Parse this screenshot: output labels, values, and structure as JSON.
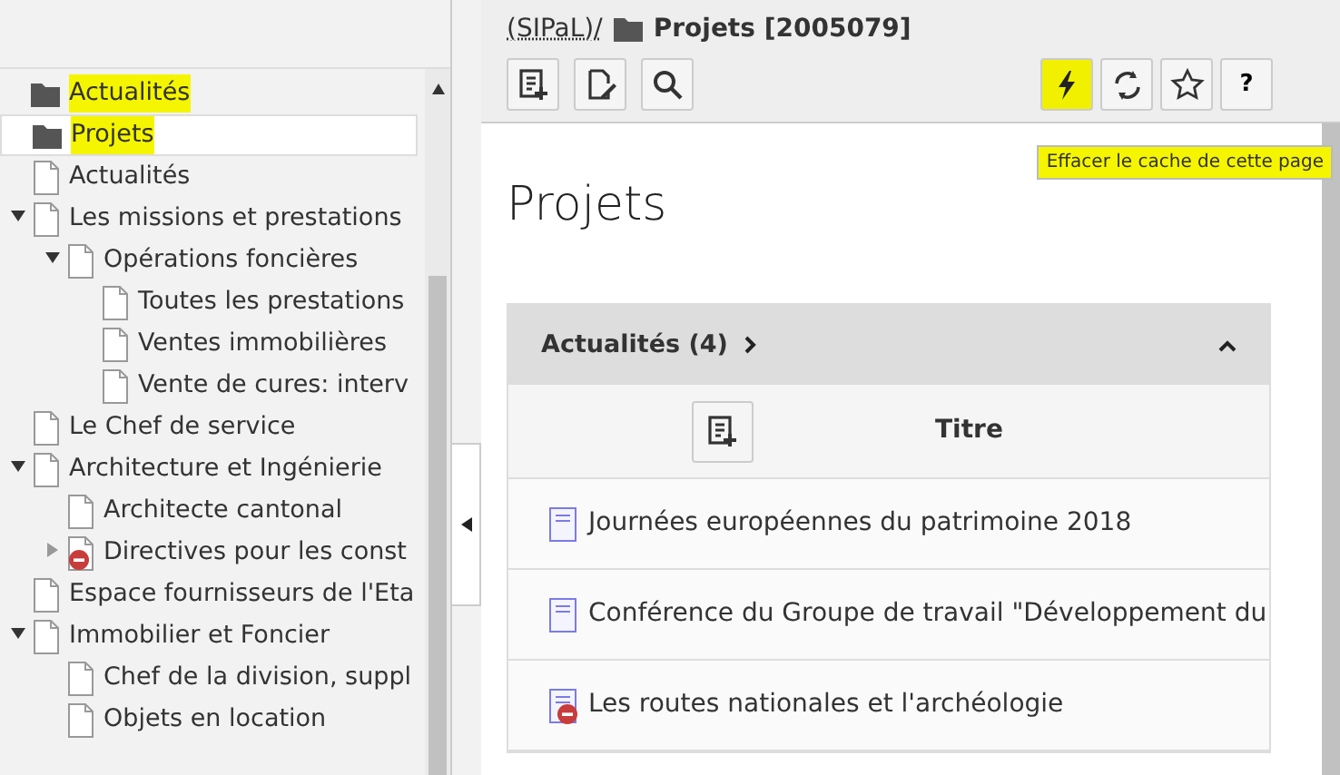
{
  "tree": [
    {
      "label": "Actualités",
      "kind": "folder",
      "highlighted": true,
      "selected": false,
      "hidden": false
    },
    {
      "label": "Projets",
      "kind": "folder",
      "highlighted": true,
      "selected": true,
      "hidden": false
    },
    {
      "label": "Actualités",
      "kind": "page",
      "highlighted": false,
      "selected": false,
      "hidden": false
    },
    {
      "label": "Les missions et prestations",
      "kind": "page",
      "highlighted": false,
      "selected": false,
      "hidden": false,
      "expanded": true,
      "children": [
        {
          "label": "Opérations foncières",
          "kind": "page",
          "highlighted": false,
          "selected": false,
          "hidden": false,
          "expanded": true,
          "children": [
            {
              "label": "Toutes les prestations",
              "kind": "page",
              "highlighted": false,
              "selected": false,
              "hidden": false
            },
            {
              "label": "Ventes immobilières",
              "kind": "page",
              "highlighted": false,
              "selected": false,
              "hidden": false
            },
            {
              "label": "Vente de cures: interv",
              "kind": "page",
              "highlighted": false,
              "selected": false,
              "hidden": false
            }
          ]
        }
      ]
    },
    {
      "label": "Le Chef de service",
      "kind": "page",
      "highlighted": false,
      "selected": false,
      "hidden": false
    },
    {
      "label": "Architecture et Ingénierie",
      "kind": "page",
      "highlighted": false,
      "selected": false,
      "hidden": false,
      "expanded": true,
      "children": [
        {
          "label": "Architecte cantonal",
          "kind": "page",
          "highlighted": false,
          "selected": false,
          "hidden": false
        },
        {
          "label": "Directives pour les const",
          "kind": "page",
          "highlighted": false,
          "selected": false,
          "hidden": true,
          "expanded": false
        }
      ]
    },
    {
      "label": "Espace fournisseurs de l'Eta",
      "kind": "page",
      "highlighted": false,
      "selected": false,
      "hidden": false
    },
    {
      "label": "Immobilier et Foncier",
      "kind": "page",
      "highlighted": false,
      "selected": false,
      "hidden": false,
      "expanded": true,
      "children": [
        {
          "label": "Chef de la division, suppl",
          "kind": "page",
          "highlighted": false,
          "selected": false,
          "hidden": false
        },
        {
          "label": "Objets en location",
          "kind": "page",
          "highlighted": false,
          "selected": false,
          "hidden": false
        }
      ]
    }
  ],
  "breadcrumb": {
    "path": "(SIPaL)/",
    "title": "Projets [2005079]"
  },
  "toolbar_left": [
    {
      "kind": "new-record"
    },
    {
      "kind": "edit"
    },
    {
      "kind": "search"
    }
  ],
  "toolbar_right": [
    {
      "kind": "clear-cache",
      "highlighted": true
    },
    {
      "kind": "refresh",
      "highlighted": false
    },
    {
      "kind": "bookmark",
      "highlighted": false
    },
    {
      "kind": "help",
      "label": "?",
      "highlighted": false
    }
  ],
  "tooltip": "Effacer le cache de cette page",
  "page_title": "Projets",
  "panel": {
    "title": "Actualités (4)",
    "expanded": true,
    "column": "Titre",
    "rows": [
      {
        "title": "Journées européennes du patrimoine 2018",
        "hidden": false
      },
      {
        "title": "Conférence du Groupe de travail \"Développement du",
        "hidden": false
      },
      {
        "title": "Les routes nationales et l'archéologie",
        "hidden": true
      }
    ]
  }
}
